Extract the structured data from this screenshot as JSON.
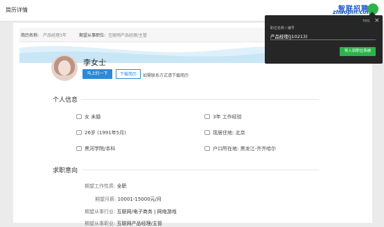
{
  "header": {
    "title": "简历详情"
  },
  "logo": {
    "cn": "智联招聘",
    "en": "zhaopin.com"
  },
  "resume_header": {
    "name_label": "简历名称:",
    "name_value": "产品经理3年",
    "position_label": "期望从事职位:",
    "position_value": "互联网产品经理/主管"
  },
  "profile": {
    "name": "李女士",
    "star": "★",
    "contact_button": "马上约一下",
    "download_button": "下载简历",
    "hint": "如需联系方式请下载简历"
  },
  "personal": {
    "title": "个人信息",
    "gender_marital": "女 未婚",
    "experience": "3年 工作经验",
    "age": "26岁 (1991年5月)",
    "residence": "现居住地: 北京",
    "education": "黑河学院/本科",
    "hukou": "户口所在地: 黑龙江-齐齐哈尔"
  },
  "job_intent": {
    "title": "求职意向",
    "job_nature_label": "期望工作性质:",
    "job_nature_value": "全职",
    "salary_label": "期望月薪:",
    "salary_value": "10001-15000元/月",
    "industry_label": "期望从事行业:",
    "industry_value": "互联网/电子商务 | 网络游戏",
    "cutoff_label": "期望从事职业:",
    "cutoff_value": "互联网产品经理/主管"
  },
  "popup": {
    "tag": "TMS",
    "close": "×",
    "label": "职位名称 / 编号",
    "value": "产品经理(J10213)",
    "import_button": "导入到职位系统"
  },
  "colors": {
    "accent": "#2a8ad8",
    "brand": "#1a56c7",
    "import": "#2db34a"
  }
}
